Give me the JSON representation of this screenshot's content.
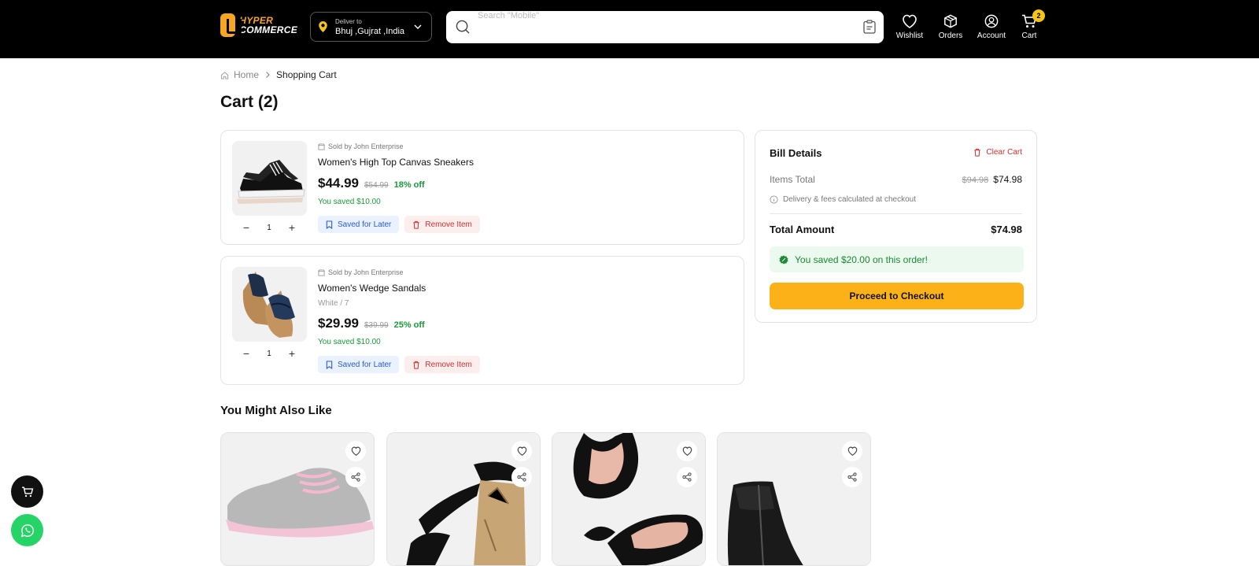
{
  "header": {
    "logo_line1": "HYPER",
    "logo_line2": "COMMERCE",
    "deliver_label": "Deliver to",
    "deliver_location": "Bhuj ,Gujrat ,India",
    "search_placeholder": "Search \"Mobile\"",
    "nav": [
      {
        "label": "Wishlist",
        "icon": "heart-icon"
      },
      {
        "label": "Orders",
        "icon": "box-icon"
      },
      {
        "label": "Account",
        "icon": "user-icon"
      },
      {
        "label": "Cart",
        "icon": "cart-icon",
        "badge": "2"
      }
    ]
  },
  "breadcrumb": {
    "home": "Home",
    "current": "Shopping Cart"
  },
  "page_title": "Cart (2)",
  "cart_items": [
    {
      "seller": "Sold by John Enterprise",
      "name": "Women's High Top Canvas Sneakers",
      "variant": "",
      "price": "$44.99",
      "mrp": "$54.99",
      "discount": "18% off",
      "saved": "You saved $10.00",
      "qty": "1",
      "save_label": "Saved for Later",
      "remove_label": "Remove Item"
    },
    {
      "seller": "Sold by John Enterprise",
      "name": "Women's Wedge Sandals",
      "variant": "White / 7",
      "price": "$29.99",
      "mrp": "$39.99",
      "discount": "25% off",
      "saved": "You saved $10.00",
      "qty": "1",
      "save_label": "Saved for Later",
      "remove_label": "Remove Item"
    }
  ],
  "bill": {
    "title": "Bill Details",
    "clear_label": "Clear Cart",
    "items_total_label": "Items Total",
    "items_total_old": "$94.98",
    "items_total": "$74.98",
    "note": "Delivery & fees calculated at checkout",
    "total_label": "Total Amount",
    "total_value": "$74.98",
    "savings": "You saved $20.00 on this order!",
    "checkout_label": "Proceed to Checkout"
  },
  "recommendations": {
    "title": "You Might Also Like"
  },
  "colors": {
    "accent": "#fbb117",
    "savings_green": "#1a9a3a",
    "remove_red": "#d32f2f",
    "save_blue": "#2a5bd7",
    "whatsapp": "#25d366"
  }
}
